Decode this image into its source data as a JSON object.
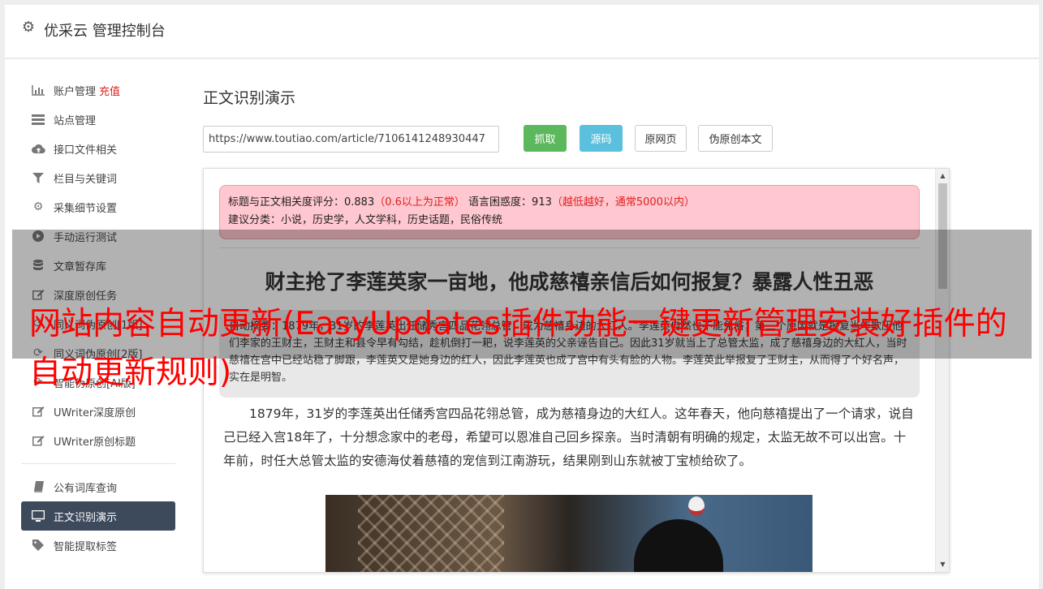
{
  "header": {
    "title": "优采云 管理控制台",
    "icon": "gear-icon"
  },
  "sidebar": {
    "items": [
      {
        "label": "账户管理",
        "extra": "充值",
        "icon": "bar-chart-icon"
      },
      {
        "label": "站点管理",
        "icon": "server-icon"
      },
      {
        "label": "接口文件相关",
        "icon": "cloud-upload-icon"
      },
      {
        "label": "栏目与关键词",
        "icon": "filter-icon"
      },
      {
        "label": "采集细节设置",
        "icon": "cogs-icon"
      },
      {
        "label": "手动运行测试",
        "icon": "play-circle-icon"
      },
      {
        "label": "文章暂存库",
        "icon": "database-icon"
      },
      {
        "label": "深度原创任务",
        "icon": "edit-icon"
      },
      {
        "label": "同义词伪原创[1版]",
        "icon": "refresh-icon"
      },
      {
        "label": "同义词伪原创[2版]",
        "icon": "refresh-icon"
      },
      {
        "label": "智能伪原创[AI版]",
        "icon": "refresh-icon"
      },
      {
        "label": "UWriter深度原创",
        "icon": "edit-icon"
      },
      {
        "label": "UWriter原创标题",
        "icon": "edit-icon"
      }
    ],
    "items2": [
      {
        "label": "公有词库查询",
        "icon": "book-icon"
      },
      {
        "label": "正文识别演示",
        "icon": "monitor-icon",
        "active": true
      },
      {
        "label": "智能提取标签",
        "icon": "tag-icon"
      }
    ]
  },
  "main": {
    "title": "正文识别演示",
    "url_value": "https://www.toutiao.com/article/7106141248930447",
    "buttons": {
      "grab": "抓取",
      "source": "源码",
      "original": "原网页",
      "pseudo": "伪原创本文"
    }
  },
  "result": {
    "score_label": "标题与正文相关度评分：0.883",
    "score_hint": "（0.6以上为正常）",
    "perplexity_label": "语言困惑度：913",
    "perplexity_hint": "（越低越好，通常5000以内）",
    "category": "建议分类：小说，历史学，人文学科，历史话题，民俗传统",
    "article_title": "财主抢了李莲英家一亩地，他成慈禧亲信后如何报复？暴露人性丑恶",
    "summary": "自动摘要：1879年，31岁的李莲英出任储秀宫四品花翎总管，成为慈禧身边的大红人。”李莲英自然也不能免俗；第三个原因就是报复当年欺压他们李家的王财主，王财主和县令早有勾结，趁机倒打一耙，说李莲英的父亲诬告自己。因此31岁就当上了总管太监，成了慈禧身边的大红人，当时慈禧在宫中已经站稳了脚跟，李莲英又是她身边的红人，因此李莲英也成了宫中有头有脸的人物。李莲英此举报复了王财主，从而得了个好名声，实在是明智。",
    "paragraph": "1879年，31岁的李莲英出任储秀宫四品花翎总管，成为慈禧身边的大红人。这年春天，他向慈禧提出了一个请求，说自己已经入宫18年了，十分想念家中的老母，希望可以恩准自己回乡探亲。当时清朝有明确的规定，太监无故不可以出宫。十年前，时任大总管太监的安德海仗着慈禧的宠信到江南游玩，结果刚到山东就被丁宝桢给砍了。"
  },
  "watermark": {
    "text": "网站内容自动更新(EasyUpdates插件功能一键更新管理安装好插件的自动更新规则)"
  }
}
